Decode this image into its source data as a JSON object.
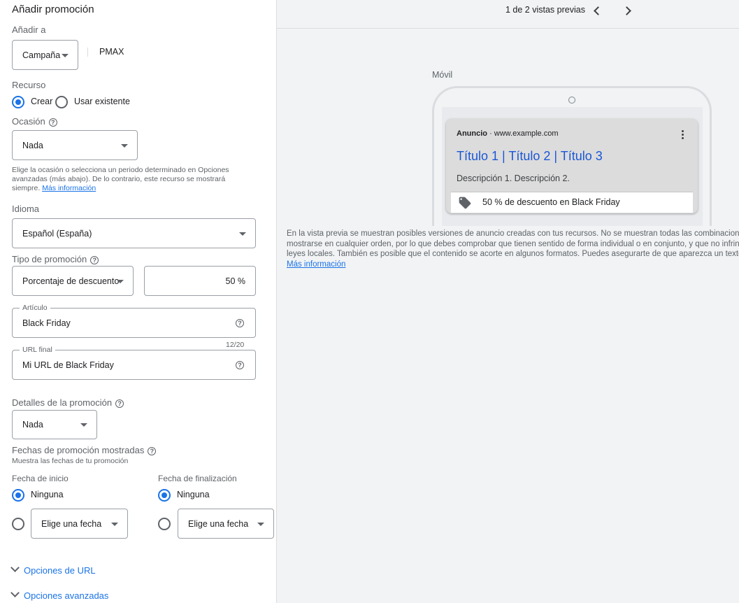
{
  "form": {
    "title": "Añadir promoción",
    "add_to": {
      "label": "Añadir a",
      "value": "Campaña",
      "campaign_name": "PMAX"
    },
    "asset": {
      "label": "Recurso",
      "option_create": "Crear",
      "option_existing": "Usar existente",
      "selected": "Crear"
    },
    "occasion": {
      "label": "Ocasión",
      "value": "Nada",
      "help_text": "Elige la ocasión o selecciona un periodo determinado en Opciones avanzadas (más abajo). De lo contrario, este recurso se mostrará siempre.",
      "help_line1": "Elige la ocasión o selecciona un periodo determinado en Opciones",
      "help_line2": "avanzadas (más abajo). De lo contrario, este recurso se mostrará",
      "help_line3": "siempre.",
      "help_link": "Más información"
    },
    "language": {
      "label": "Idioma",
      "value": "Español (España)"
    },
    "promo_type": {
      "label": "Tipo de promoción",
      "value": "Porcentaje de descuento",
      "amount": "50 %"
    },
    "item": {
      "label": "Artículo",
      "value": "Black Friday",
      "counter": "12/20"
    },
    "final_url": {
      "label": "URL final",
      "value": "Mi URL de Black Friday"
    },
    "promo_details": {
      "label": "Detalles de la promoción",
      "value": "Nada"
    },
    "dates": {
      "label": "Fechas de promoción mostradas",
      "sublabel": "Muestra las fechas de tu promoción",
      "start": {
        "label": "Fecha de inicio",
        "option_none": "Ninguna",
        "picker": "Elige una fecha",
        "selected": "Ninguna"
      },
      "end": {
        "label": "Fecha de finalización",
        "option_none": "Ninguna",
        "picker": "Elige una fecha",
        "selected": "Ninguna"
      }
    },
    "url_options": "Opciones de URL",
    "advanced_options": "Opciones avanzadas"
  },
  "preview": {
    "pager": "1 de 2 vistas previas",
    "device_label": "Móvil",
    "ad": {
      "label": "Anuncio",
      "separator": "·",
      "domain": "www.example.com",
      "headline": "Título 1 | Título 2 | Título 3",
      "description": "Descripción 1. Descripción 2.",
      "promotion": "50 % de descuento en Black Friday"
    },
    "note_line1": "En la vista previa se muestran posibles versiones de anuncio creadas con tus recursos. No se muestran todas las combinaciones. Los recursos pueden",
    "note_line2": "mostrarse en cualquier orden, por lo que debes comprobar que tienen sentido de forma individual o en conjunto, y que no infringen nuestras políticas o",
    "note_line3": "leyes locales. También es posible que el contenido se acorte en algunos formatos. Puedes asegurarte de que aparezca un texto concreto.",
    "note_link": "Más información"
  },
  "colors": {
    "accent": "#1a73e8",
    "headline": "#1a57d6",
    "panel_bg": "#f1f3f4"
  },
  "icons": [
    "help-icon",
    "caret-down-icon",
    "chevron-left-icon",
    "chevron-right-icon",
    "more-vert-icon",
    "tag-icon",
    "expand-chevron-icon"
  ]
}
